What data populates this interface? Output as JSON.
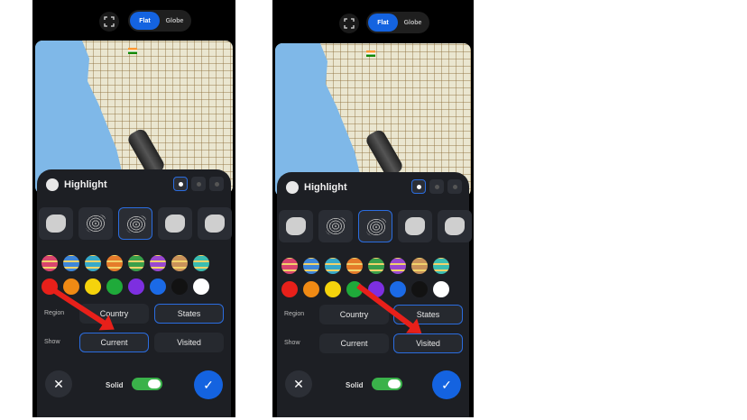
{
  "colors": {
    "accent": "#1463e0",
    "panel": "#1d1f24",
    "switch": "#3ab24a",
    "arrow": "#e8201a"
  },
  "icons": {
    "fullscreen": "fullscreen-icon",
    "close": "close-icon",
    "confirm": "check-icon",
    "highlight": "highlight-icon",
    "flag": "india-flag-icon"
  },
  "screens": [
    {
      "view_toggle": {
        "flat": "Flat",
        "globe": "Globe"
      },
      "highlight": {
        "title": "Highlight"
      },
      "region": {
        "label": "Region",
        "country": "Country",
        "states": "States",
        "selected": "States"
      },
      "show": {
        "label": "Show",
        "current": "Current",
        "visited": "Visited",
        "selected": "Current"
      },
      "solid_label": "Solid"
    },
    {
      "view_toggle": {
        "flat": "Flat",
        "globe": "Globe"
      },
      "highlight": {
        "title": "Highlight"
      },
      "region": {
        "label": "Region",
        "country": "Country",
        "states": "States",
        "selected": "States"
      },
      "show": {
        "label": "Show",
        "current": "Current",
        "visited": "Visited",
        "selected": "Visited"
      },
      "solid_label": "Solid"
    }
  ],
  "pattern_swatches": [
    "#d9456e",
    "#3f86d8",
    "#37a9c8",
    "#e57b2a",
    "#3aa04a",
    "#9a48d0",
    "#c9925a",
    "#3bbdb0"
  ],
  "solid_swatches": [
    "#e8201a",
    "#f08a14",
    "#f5d30c",
    "#1faa3a",
    "#7d2fe0",
    "#1b6ae6",
    "#121212",
    "#ffffff"
  ]
}
